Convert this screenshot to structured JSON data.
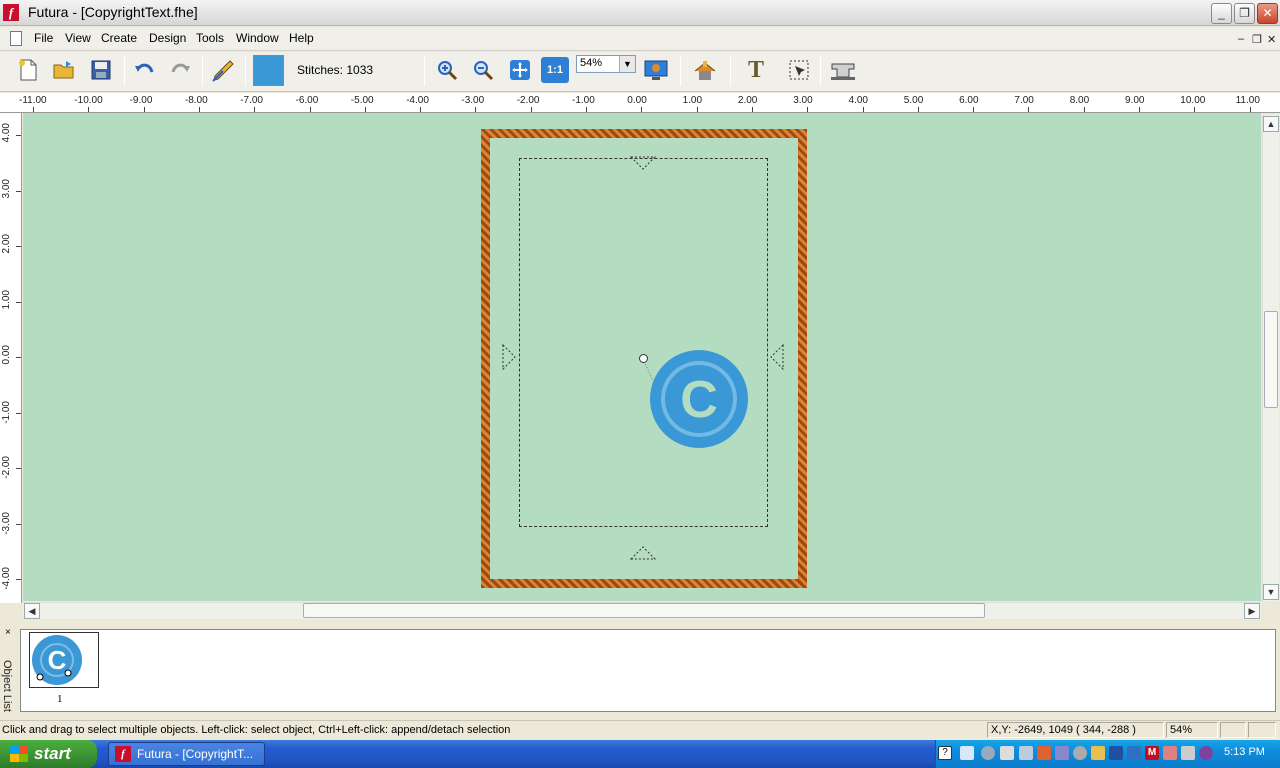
{
  "window": {
    "title": "Futura - [CopyrightText.fhe]",
    "icon": "f"
  },
  "menu": {
    "items": [
      "File",
      "View",
      "Create",
      "Design",
      "Tools",
      "Window",
      "Help"
    ]
  },
  "toolbar": {
    "buttons": [
      "new-file-icon",
      "open-folder-icon",
      "save-disk-icon",
      "undo-icon",
      "redo-icon",
      "design-pencil-icon",
      "color-swatch-icon",
      "zoom-in-icon",
      "zoom-out-icon",
      "fit-to-window-icon",
      "one-to-one-icon",
      "realistic-view-icon",
      "auto-digitize-icon",
      "text-icon",
      "select-area-icon",
      "sewing-machine-icon"
    ],
    "one_to_one_label": "1:1",
    "text_tool_label": "T",
    "stitches_label": "Stitches: 1033",
    "zoom_value": "54%",
    "swatch_color": "#3b98d6"
  },
  "ruler": {
    "horizontal": [
      "-11.00",
      "-10.00",
      "-9.00",
      "-8.00",
      "-7.00",
      "-6.00",
      "-5.00",
      "-4.00",
      "-3.00",
      "-2.00",
      "-1.00",
      "0.00",
      "1.00",
      "2.00",
      "3.00",
      "4.00",
      "5.00",
      "6.00",
      "7.00",
      "8.00",
      "9.00",
      "10.00",
      "11.00"
    ],
    "vertical": [
      "4.00",
      "3.00",
      "2.00",
      "1.00",
      "0.00",
      "-1.00",
      "-2.00",
      "-3.00",
      "-4.00"
    ]
  },
  "canvas": {
    "background": "#b4dcc0",
    "design_color": "#3b98d6",
    "design_glyph": "C"
  },
  "object_list": {
    "label": "Object List",
    "close": "×",
    "items": [
      {
        "number": "1",
        "glyph": "C"
      }
    ]
  },
  "status": {
    "message": "Click and drag to select multiple objects. Left-click: select object, Ctrl+Left-click: append/detach selection",
    "coords": "X,Y: -2649, 1049  ( 344, -288 )",
    "zoom": "54%"
  },
  "taskbar": {
    "start": "start",
    "task": "Futura - [CopyrightT...",
    "clock": "5:13 PM"
  },
  "window_controls": {
    "minimize": "_",
    "restore": "❐",
    "close": "✕",
    "mdi_min": "–",
    "mdi_restore": "❐",
    "mdi_close": "✕"
  }
}
